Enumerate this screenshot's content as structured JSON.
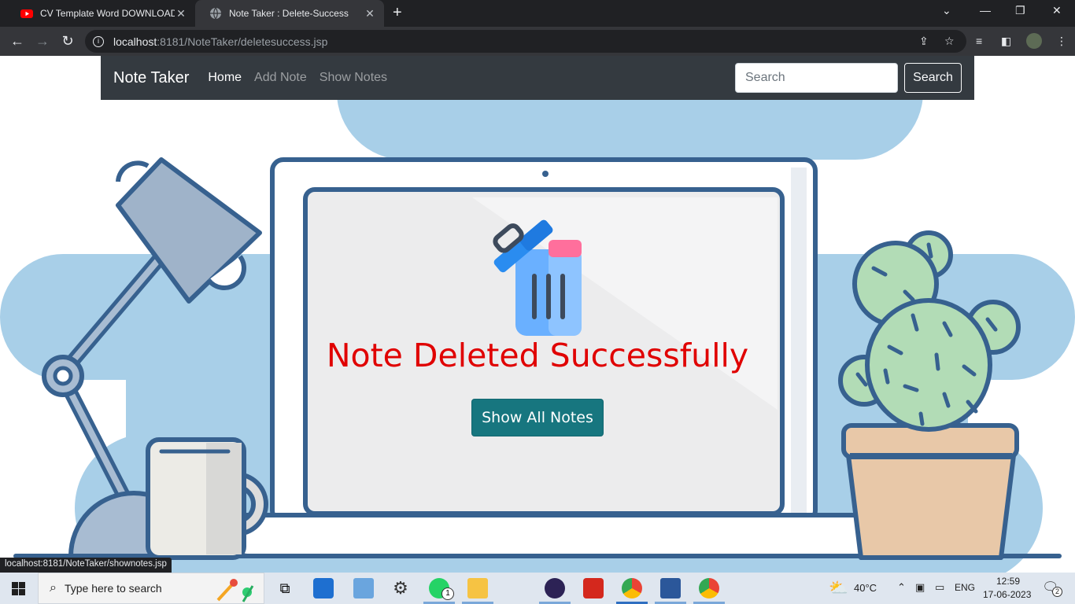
{
  "browser": {
    "tabs": [
      {
        "title": "CV Template Word DOWNLOAD | ",
        "favicon": "youtube-icon",
        "active": false
      },
      {
        "title": "Note Taker : Delete-Success",
        "favicon": "globe-icon",
        "active": true
      }
    ],
    "url_host": "localhost",
    "url_rest": ":8181/NoteTaker/deletesuccess.jsp",
    "status_url": "localhost:8181/NoteTaker/shownotes.jsp"
  },
  "navbar": {
    "brand": "Note Taker",
    "links": [
      "Home",
      "Add Note",
      "Show Notes"
    ],
    "search_placeholder": "Search",
    "search_button": "Search"
  },
  "main": {
    "message": "Note Deleted Successfully",
    "button": "Show All Notes",
    "message_color": "#e00000",
    "button_color": "#17767f"
  },
  "taskbar": {
    "search_placeholder": "Type here to search",
    "temperature": "40°C",
    "language": "ENG",
    "time": "12:59",
    "date": "17-06-2023",
    "whatsapp_badge": "1",
    "notification_count": "2"
  }
}
